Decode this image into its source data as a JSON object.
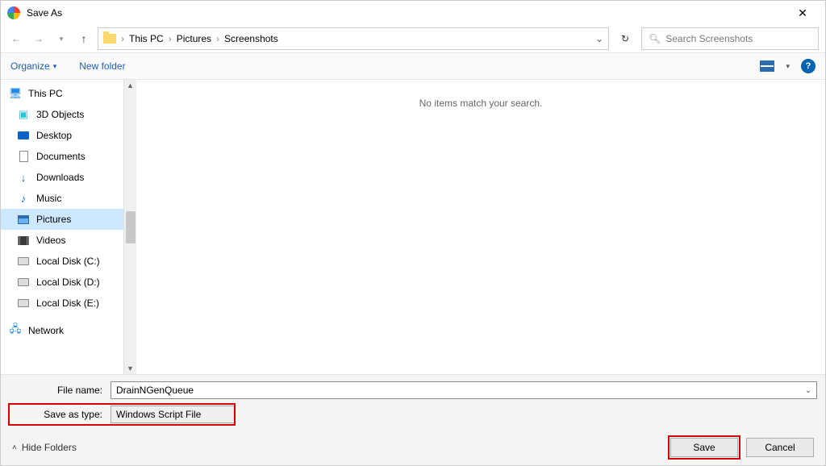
{
  "title": "Save As",
  "breadcrumb": {
    "root": "This PC",
    "mid": "Pictures",
    "leaf": "Screenshots"
  },
  "search_placeholder": "Search Screenshots",
  "toolbar": {
    "organize": "Organize",
    "new_folder": "New folder"
  },
  "tree": {
    "root": "This PC",
    "items": [
      {
        "label": "3D Objects"
      },
      {
        "label": "Desktop"
      },
      {
        "label": "Documents"
      },
      {
        "label": "Downloads"
      },
      {
        "label": "Music"
      },
      {
        "label": "Pictures",
        "selected": true
      },
      {
        "label": "Videos"
      },
      {
        "label": "Local Disk (C:)"
      },
      {
        "label": "Local Disk (D:)"
      },
      {
        "label": "Local Disk (E:)"
      }
    ],
    "network": "Network"
  },
  "empty_message": "No items match your search.",
  "filename_label": "File name:",
  "filename_value": "DrainNGenQueue",
  "savetype_label": "Save as type:",
  "savetype_value": "Windows Script File",
  "hide_folders": "Hide Folders",
  "buttons": {
    "save": "Save",
    "cancel": "Cancel"
  }
}
